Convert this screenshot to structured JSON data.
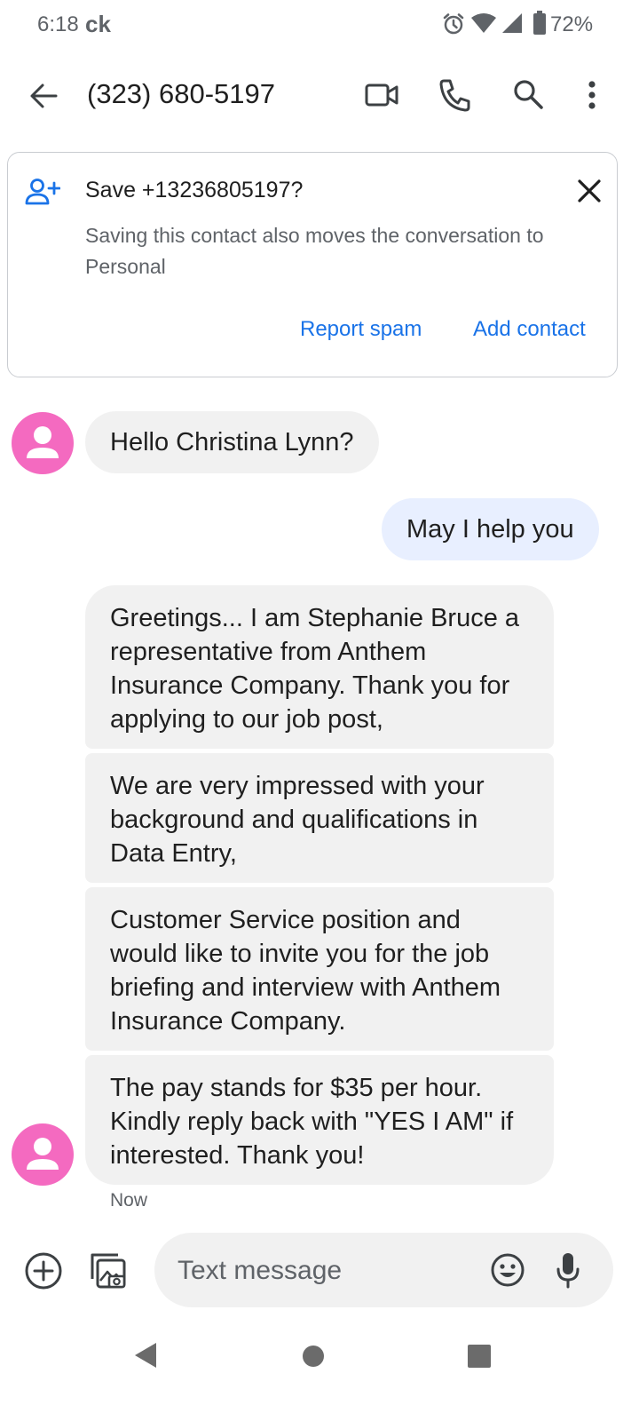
{
  "status_bar": {
    "time": "6:18",
    "carrier": "ck",
    "battery": "72%",
    "icons": [
      "alarm-icon",
      "wifi-icon",
      "signal-icon",
      "battery-icon"
    ]
  },
  "app_bar": {
    "title": "(323) 680-5197",
    "icons": [
      "back-arrow-icon",
      "video-call-icon",
      "phone-icon",
      "search-icon",
      "more-vert-icon"
    ]
  },
  "save_card": {
    "title": "Save +13236805197?",
    "description": "Saving this contact also moves the conversation to Personal",
    "report_spam_label": "Report spam",
    "add_contact_label": "Add contact",
    "icons": [
      "add-person-icon",
      "close-icon"
    ]
  },
  "messages": [
    {
      "direction": "incoming",
      "text": "Hello Christina Lynn?"
    },
    {
      "direction": "outgoing",
      "text": "May I help you"
    },
    {
      "direction": "incoming",
      "text": "Greetings... I am Stephanie Bruce a representative from Anthem Insurance Company. Thank you for applying to our job post,"
    },
    {
      "direction": "incoming",
      "text": "We are very impressed with your background and qualifications in Data Entry,"
    },
    {
      "direction": "incoming",
      "text": "Customer Service position and would like to invite you for the job briefing and interview with Anthem Insurance Company."
    },
    {
      "direction": "incoming",
      "text": "The pay stands for $35 per hour. Kindly reply back with \"YES I AM\" if interested. Thank you!"
    }
  ],
  "timestamp": "Now",
  "compose": {
    "placeholder": "Text message",
    "icons": [
      "add-circle-icon",
      "gallery-icon",
      "emoji-icon",
      "mic-icon"
    ]
  },
  "colors": {
    "accent_blue": "#1a73e8",
    "avatar_pink": "#f46ac0",
    "incoming_bubble": "#f1f1f1",
    "outgoing_bubble": "#e8efff"
  },
  "nav_bar": {
    "icons": [
      "nav-back-icon",
      "nav-home-icon",
      "nav-recents-icon"
    ]
  }
}
